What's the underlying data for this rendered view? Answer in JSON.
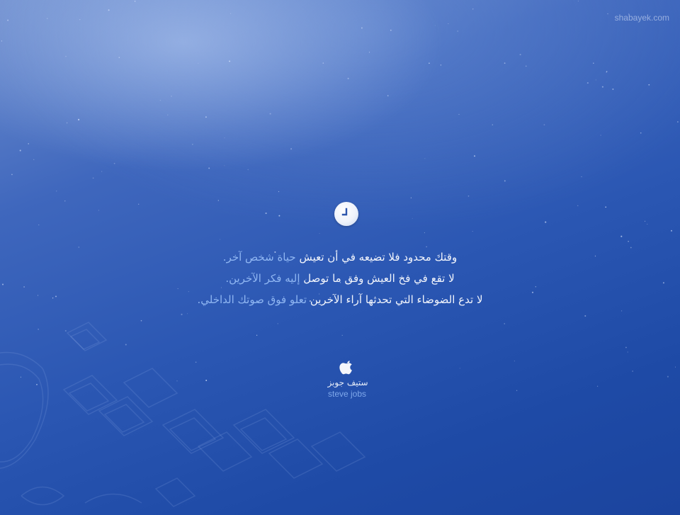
{
  "site": {
    "watermark": "shabayek.com"
  },
  "icons": {
    "clock": "clock-icon",
    "apple": "apple-logo-icon"
  },
  "colors": {
    "background_top": "#6f8fcf",
    "background_bottom": "#1b449e",
    "text_white": "#f2f5fc",
    "text_blue": "#8fb6f2",
    "author_en": "#7fa8ea"
  },
  "quote": {
    "lines": [
      {
        "white": "وقتك محدود فلا تضيعه في أن تعيش ",
        "blue": "حياة شخص آخر."
      },
      {
        "white": "لا تقع في فخ العيش وفق ما توصل ",
        "blue": "إليه فكر الآخرين."
      },
      {
        "white": "لا تدع الضوضاء التي تحدثها آراء الآخرين ",
        "blue": "تعلو فوق صوتك الداخلي."
      }
    ]
  },
  "author": {
    "arabic": "ستيف جوبز",
    "english": "steve jobs"
  }
}
